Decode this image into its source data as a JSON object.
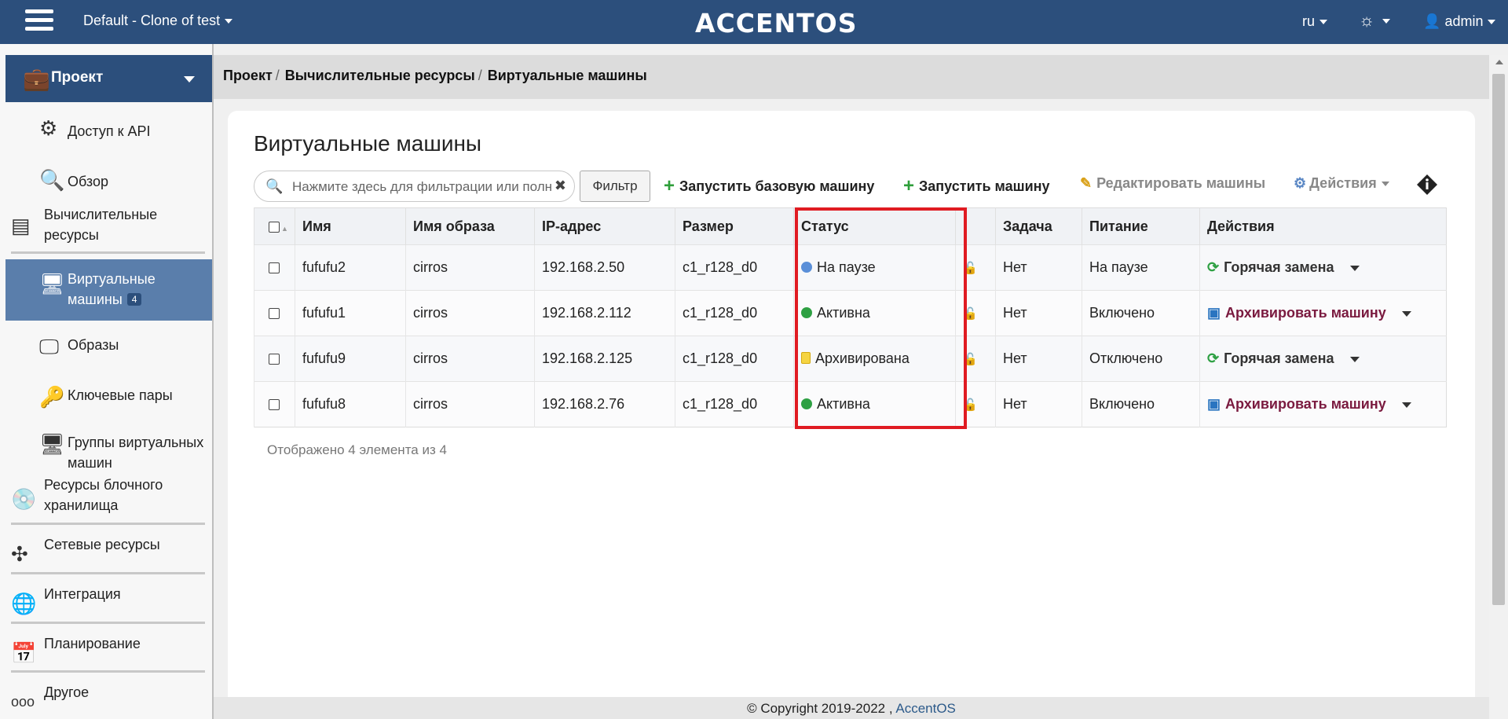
{
  "topbar": {
    "project": "Default - Clone of test",
    "logo": "ACCENTOS",
    "lang": "ru",
    "user": "admin"
  },
  "sidebar": {
    "project_label": "Проект",
    "items": [
      {
        "label": "Доступ к API",
        "icon": "api-access-icon"
      },
      {
        "label": "Обзор",
        "icon": "overview-icon"
      },
      {
        "label": "Вычислительные ресурсы",
        "icon": "compute-icon"
      },
      {
        "label": "Виртуальные машины",
        "icon": "vm-icon",
        "badge": "4"
      },
      {
        "label": "Образы",
        "icon": "images-icon"
      },
      {
        "label": "Ключевые пары",
        "icon": "keypairs-icon"
      },
      {
        "label": "Группы виртуальных машин",
        "icon": "vm-groups-icon"
      },
      {
        "label": "Ресурсы блочного хранилища",
        "icon": "block-storage-icon"
      },
      {
        "label": "Сетевые ресурсы",
        "icon": "network-icon"
      },
      {
        "label": "Интеграция",
        "icon": "integration-icon"
      },
      {
        "label": "Планирование",
        "icon": "planning-icon"
      },
      {
        "label": "Другое",
        "icon": "other-icon"
      }
    ]
  },
  "breadcrumb": [
    "Проект",
    "Вычислительные ресурсы",
    "Виртуальные машины"
  ],
  "main": {
    "title": "Виртуальные машины",
    "search_placeholder": "Нажмите здесь для фильтрации или полнотекстового поиска",
    "filter_label": "Фильтр",
    "launch_base": "Запустить базовую машину",
    "launch": "Запустить машину",
    "edit": "Редактировать машины",
    "actions": "Действия",
    "count_text": "Отображено 4 элемента из 4"
  },
  "table": {
    "columns": [
      "Имя",
      "Имя образа",
      "IP-адрес",
      "Размер",
      "Статус",
      "",
      "Задача",
      "Питание",
      "Действия"
    ],
    "rows": [
      {
        "name": "fufufu2",
        "image": "cirros",
        "ip": "192.168.2.50",
        "size": "c1_r128_d0",
        "status": "На паузе",
        "status_kind": "pause",
        "task": "Нет",
        "power": "На паузе",
        "action": "Горячая замена",
        "action_kind": "hot"
      },
      {
        "name": "fufufu1",
        "image": "cirros",
        "ip": "192.168.2.112",
        "size": "c1_r128_d0",
        "status": "Активна",
        "status_kind": "active",
        "task": "Нет",
        "power": "Включено",
        "action": "Архивировать машину",
        "action_kind": "archive"
      },
      {
        "name": "fufufu9",
        "image": "cirros",
        "ip": "192.168.2.125",
        "size": "c1_r128_d0",
        "status": "Архивирована",
        "status_kind": "archived",
        "task": "Нет",
        "power": "Отключено",
        "action": "Горячая замена",
        "action_kind": "hot"
      },
      {
        "name": "fufufu8",
        "image": "cirros",
        "ip": "192.168.2.76",
        "size": "c1_r128_d0",
        "status": "Активна",
        "status_kind": "active",
        "task": "Нет",
        "power": "Включено",
        "action": "Архивировать машину",
        "action_kind": "archive"
      }
    ]
  },
  "footer": {
    "copyright": "© Copyright 2019-2022 ,",
    "link": "AccentOS"
  },
  "colors": {
    "header": "#2c4f7c",
    "active_nav": "#5a7eab",
    "highlight": "#e01b22",
    "status_active": "#2ea043",
    "archive_action": "#7a1a3f"
  }
}
